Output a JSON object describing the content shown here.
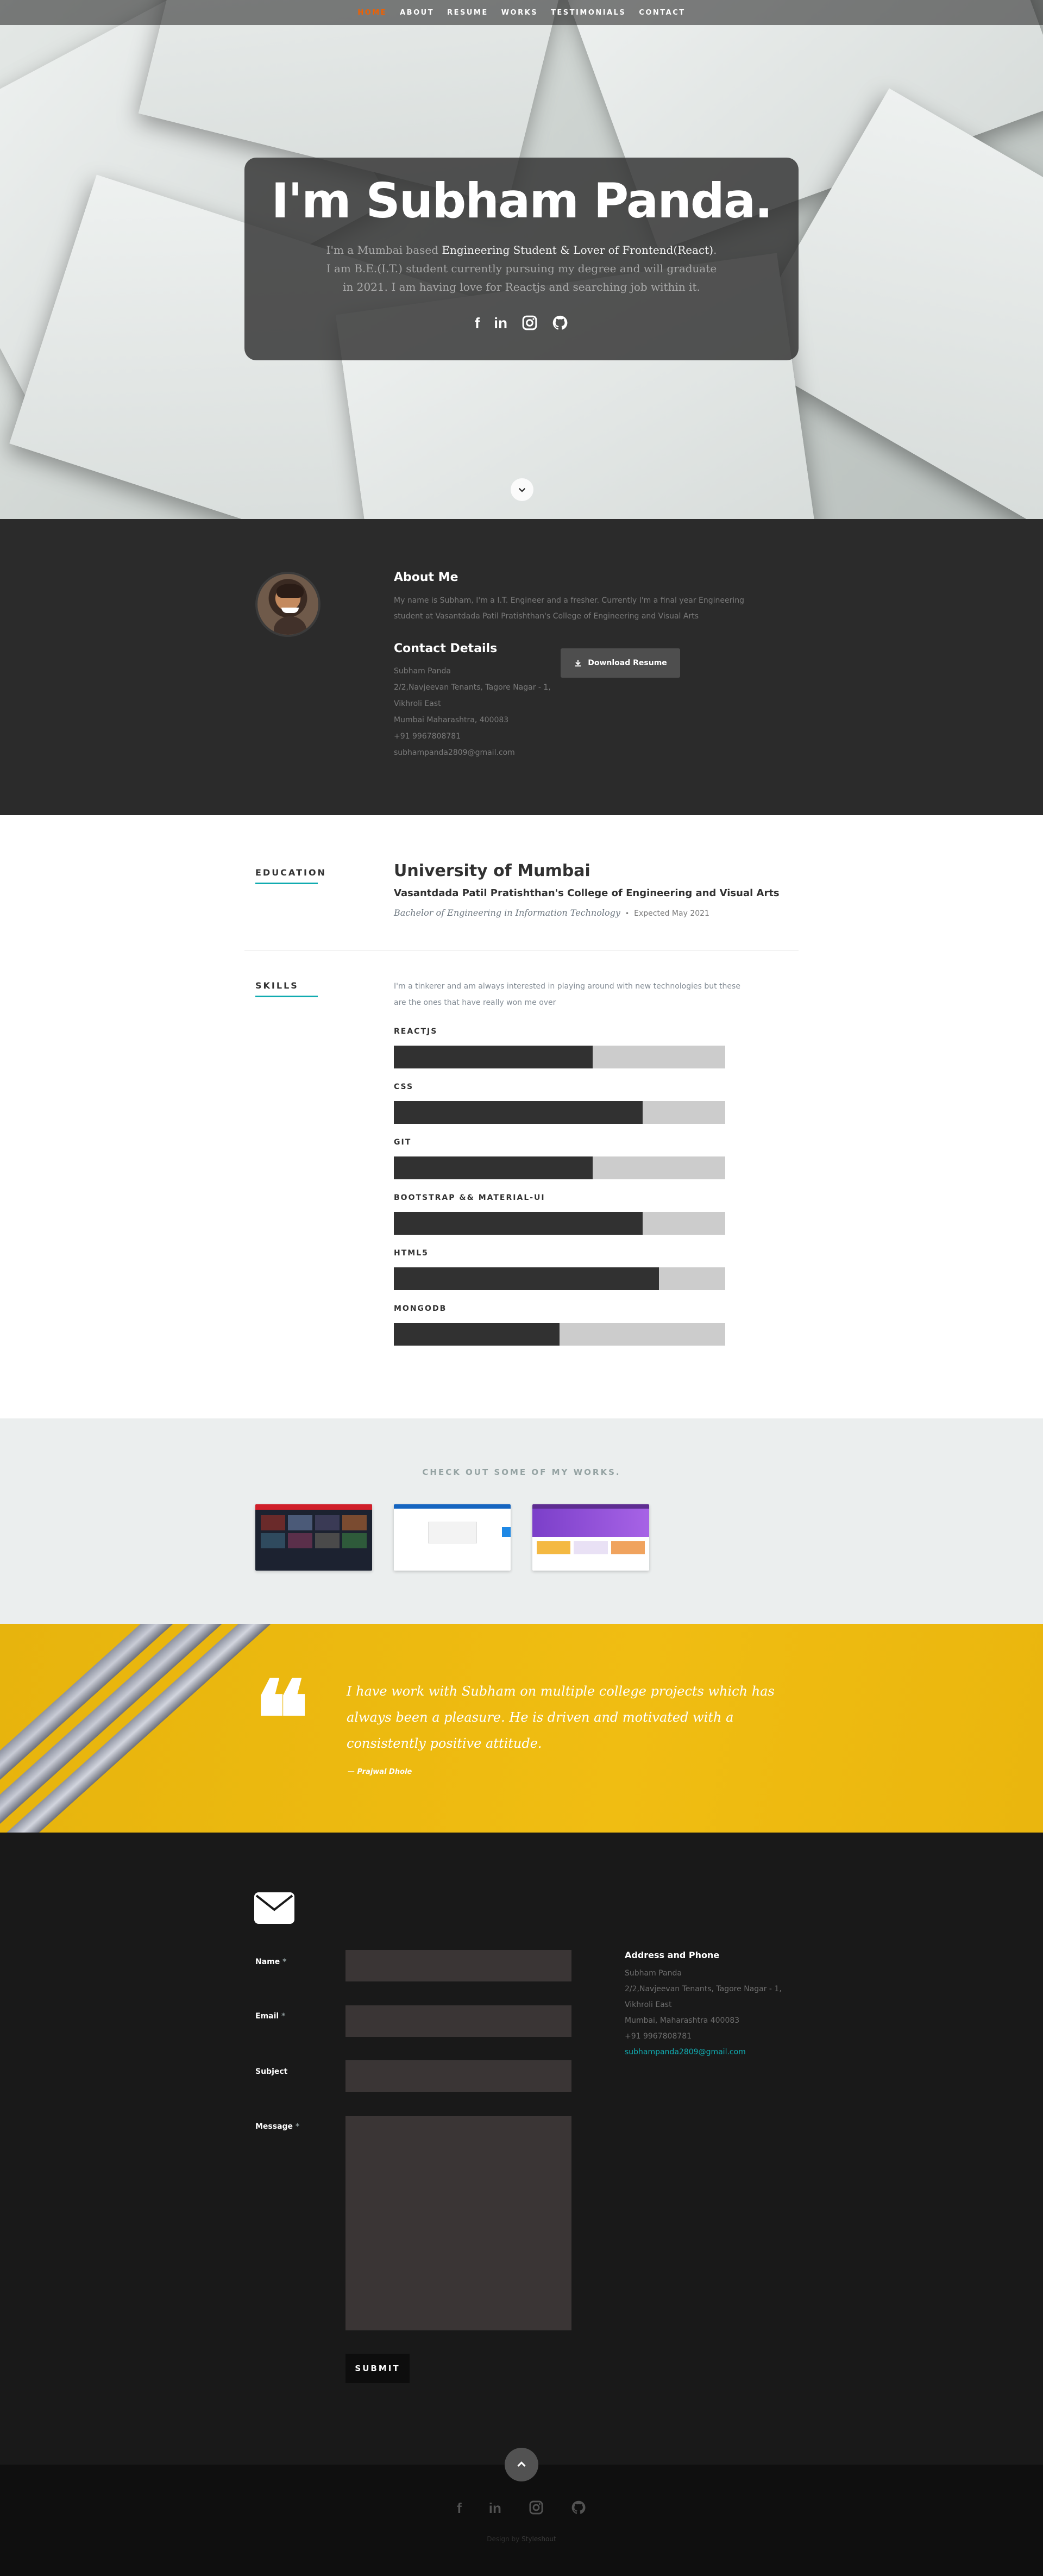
{
  "nav": {
    "items": [
      "Home",
      "About",
      "Resume",
      "Works",
      "Testimonials",
      "Contact"
    ]
  },
  "hero": {
    "title": "I'm Subham Panda.",
    "text_before": "I'm a Mumbai based",
    "text_highlight": "Engineering Student & Lover of Frontend(React)",
    "text_after": ". I am B.E.(I.T.) student currently pursuing my degree and will graduate in 2021. I am having love for Reactjs and searching job within it.",
    "social": [
      "facebook-icon",
      "linkedin-icon",
      "instagram-icon",
      "github-icon"
    ]
  },
  "about": {
    "heading": "About Me",
    "body": "My name is Subham, I'm a I.T. Engineer and a fresher. Currently I'm a final year Engineering student at Vasantdada Patil Pratishthan's College of Engineering and Visual Arts",
    "contact_heading": "Contact Details",
    "contact_lines": [
      "Subham Panda",
      "2/2,Navjeevan Tenants, Tagore Nagar - 1,",
      "Vikhroli East",
      "Mumbai Maharashtra, 400083",
      "+91 9967808781",
      "subhampanda2809@gmail.com"
    ],
    "download_label": "Download Resume"
  },
  "resume": {
    "education_label": "EDUCATION",
    "university": "University of Mumbai",
    "college": "Vasantdada Patil Pratishthan's College of Engineering and Visual Arts",
    "degree": "Bachelor of Engineering in Information Technology",
    "bullet": "•",
    "date": "Expected May 2021",
    "skills_label": "SKILLS",
    "skills_intro": "I'm a tinkerer and am always interested in playing around with new technologies but these are the ones that have really won me over",
    "skills": [
      {
        "name": "REACTJS",
        "level": 0.6
      },
      {
        "name": "CSS",
        "level": 0.75
      },
      {
        "name": "GIT",
        "level": 0.6
      },
      {
        "name": "BOOTSTRAP && MATERIAL-UI",
        "level": 0.75
      },
      {
        "name": "HTML5",
        "level": 0.8
      },
      {
        "name": "MONGODB",
        "level": 0.5
      }
    ]
  },
  "works": {
    "heading": "CHECK OUT SOME OF MY WORKS."
  },
  "testimonial": {
    "quote_mark": "❝",
    "quote": "I have work with Subham on multiple college projects which has always been a pleasure. He is driven and motivated with a consistently positive attitude.",
    "cite": "— Prajwal Dhole"
  },
  "contact": {
    "fields": [
      {
        "label": "Name",
        "required": true
      },
      {
        "label": "Email",
        "required": true
      },
      {
        "label": "Subject",
        "required": false
      },
      {
        "label": "Message",
        "required": true
      }
    ],
    "required_mark": "*",
    "submit_label": "SUBMIT",
    "address_heading": "Address and Phone",
    "address_lines": [
      "Subham Panda",
      "2/2,Navjeevan Tenants, Tagore Nagar - 1,",
      "Vikhroli East",
      "Mumbai, Maharashtra 400083",
      "+91 9967808781"
    ],
    "address_email": "subhampanda2809@gmail.com"
  },
  "footer": {
    "credit_prefix": "Design by",
    "credit_name": "Styleshout"
  }
}
